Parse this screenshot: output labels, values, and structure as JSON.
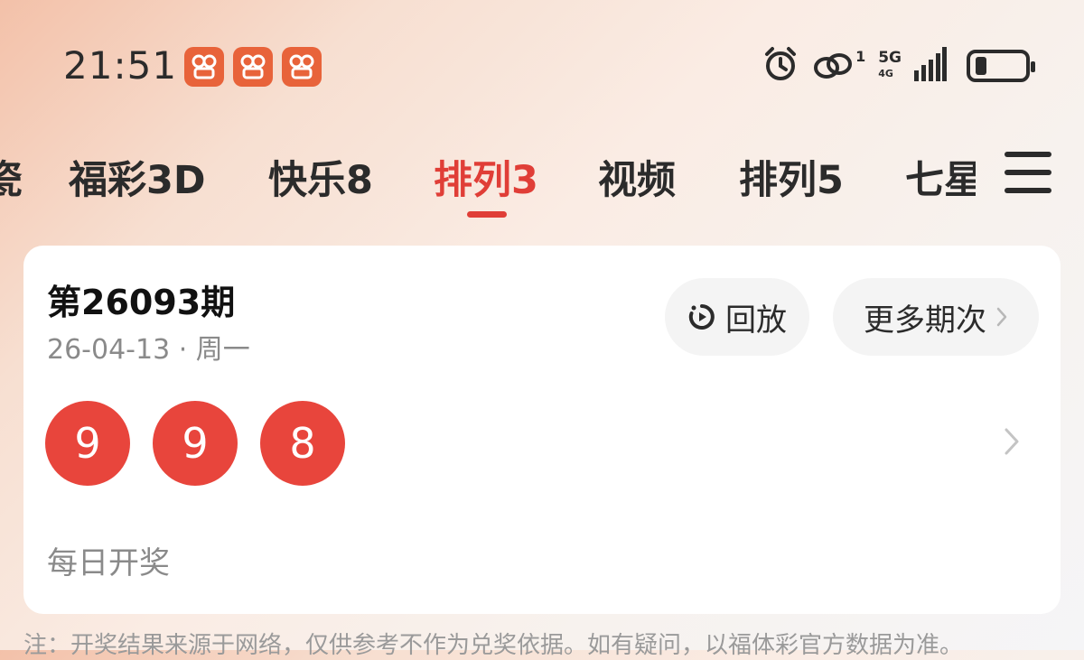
{
  "status_bar": {
    "time": "21:51",
    "notification_icons": [
      "app-notification-icon",
      "app-notification-icon",
      "app-notification-icon"
    ],
    "sim_label": "1",
    "network_label": "5G",
    "network_sub_label": "4G",
    "icons": [
      "alarm-icon",
      "hotspot-link-icon",
      "signal-bars-icon",
      "battery-icon"
    ],
    "accent_color": "#e8633a"
  },
  "tabs": {
    "items": [
      {
        "label": "瓷"
      },
      {
        "label": "福彩3D"
      },
      {
        "label": "快乐8"
      },
      {
        "label": "排列3"
      },
      {
        "label": "视频"
      },
      {
        "label": "排列5"
      },
      {
        "label": "七星"
      }
    ],
    "active_index": 3,
    "active_color": "#e03e37"
  },
  "draw_card": {
    "issue_title": "第26093期",
    "date_line": "26-04-13 · 周一",
    "replay_label": "回放",
    "more_label": "更多期次",
    "balls": [
      "9",
      "9",
      "8"
    ],
    "ball_color": "#e8453c",
    "frequency_label": "每日开奖"
  },
  "disclaimer": "注：开奖结果来源于网络，仅供参考不作为兑奖依据。如有疑问，以福体彩官方数据为准。"
}
